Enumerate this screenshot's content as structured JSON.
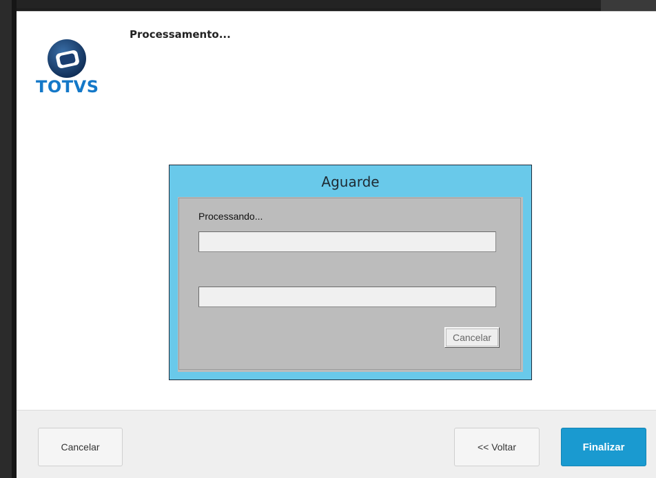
{
  "app": {
    "logo_text": "TOTVS",
    "page_title": "Processamento..."
  },
  "modal": {
    "title": "Aguarde",
    "status_label": "Processando...",
    "field1_value": "",
    "field2_value": "",
    "cancel_label": "Cancelar"
  },
  "footer": {
    "cancel_label": "Cancelar",
    "back_label": "<< Voltar",
    "finish_label": "Finalizar"
  },
  "colors": {
    "brand_blue": "#1478c8",
    "modal_bg": "#69c9ea",
    "finish_button": "#1a9ad0"
  },
  "icons": {
    "logo": "totvs-logo-icon"
  }
}
